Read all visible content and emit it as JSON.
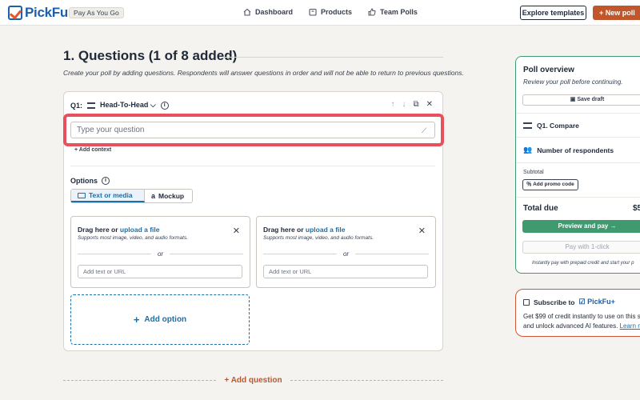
{
  "brand": {
    "name": "PickFu",
    "plan_badge": "Pay As You Go",
    "accent": "#c2562b",
    "primary_blue": "#1d6fa8",
    "success_green": "#3f9a6f"
  },
  "nav": {
    "links": [
      {
        "label": "Dashboard",
        "icon": "home-icon"
      },
      {
        "label": "Products",
        "icon": "box-icon"
      },
      {
        "label": "Team Polls",
        "icon": "thumbs-up-icon"
      }
    ],
    "explore_label": "Explore templates",
    "new_poll_label": "New poll"
  },
  "main": {
    "title": "1. Questions (1 of 8 added)",
    "subtitle": "Create your poll by adding questions. Respondents will answer questions in order and will not be able to return to previous questions.",
    "question": {
      "number_label": "Q1:",
      "type_label": "Head-To-Head",
      "placeholder": "Type your question",
      "add_context_label": "Add context",
      "options_label": "Options",
      "tabs": [
        {
          "label": "Text or media",
          "active": true
        },
        {
          "label": "Mockup",
          "active": false
        }
      ],
      "options": [
        {
          "drag_prefix": "Drag here or ",
          "drag_link": "upload a file",
          "supports": "Supports most image, video, and audio formats.",
          "or": "or",
          "input_placeholder": "Add text or URL"
        },
        {
          "drag_prefix": "Drag here or ",
          "drag_link": "upload a file",
          "supports": "Supports most image, video, and audio formats.",
          "or": "or",
          "input_placeholder": "Add text or URL"
        }
      ],
      "add_option_label": "Add option"
    },
    "add_question_label": "Add question"
  },
  "overview": {
    "title": "Poll overview",
    "subtitle": "Review your poll before continuing.",
    "save_draft_label": "Save draft",
    "items": [
      {
        "label": "Q1. Compare",
        "icon": "compare-icon"
      },
      {
        "label": "Number of respondents",
        "icon": "people-icon"
      }
    ],
    "subtotal_label": "Subtotal",
    "promo_label": "Add promo code",
    "total_label": "Total due",
    "total_amount": "$5",
    "preview_pay_label": "Preview and pay",
    "pay_1click_label": "Pay with 1-click",
    "instantly_text": "Instantly pay with prepaid credit and start your p"
  },
  "subscribe": {
    "label": "Subscribe to",
    "brand_plus": "PickFu+",
    "line1": "Get $99 of credit instantly to use on this su",
    "line2": "and unlock advanced AI features.",
    "learn_more": "Learn m"
  }
}
